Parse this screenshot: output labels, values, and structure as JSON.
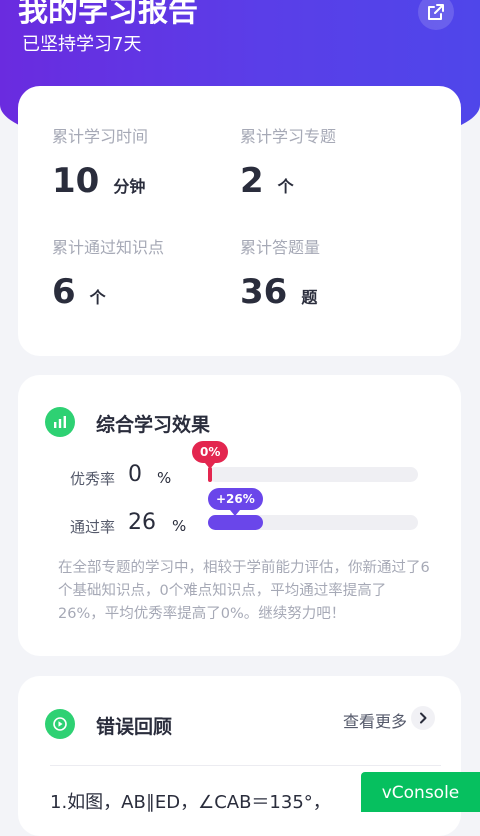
{
  "header": {
    "title": "我的学习报告",
    "subtitle": "已坚持学习7天",
    "share_icon": "share-external-icon"
  },
  "stats": [
    {
      "label": "累计学习时间",
      "value": "10",
      "unit": "分钟"
    },
    {
      "label": "累计学习专题",
      "value": "2",
      "unit": "个"
    },
    {
      "label": "累计通过知识点",
      "value": "6",
      "unit": "个"
    },
    {
      "label": "累计答题量",
      "value": "36",
      "unit": "题"
    }
  ],
  "effect": {
    "title": "综合学习效果",
    "icon": "bar-chart-icon",
    "rates": [
      {
        "label": "优秀率",
        "value": "0",
        "unit": "%",
        "bubble": "0%",
        "fraction": 0.0,
        "color": "#e3264f"
      },
      {
        "label": "通过率",
        "value": "26",
        "unit": "%",
        "bubble": "+26%",
        "fraction": 0.26,
        "color": "#6a46ea"
      }
    ],
    "summary": "在全部专题的学习中，相较于学前能力评估，你新通过了6个基础知识点，0个难点知识点，平均通过率提高了26%，平均优秀率提高了0%。继续努力吧！"
  },
  "review": {
    "title": "错误回顾",
    "icon": "play-icon",
    "more_label": "查看更多",
    "more_icon": "chevron-right-icon",
    "first_question": "1.如图，AB∥ED，∠CAB＝135°，"
  },
  "vconsole": {
    "label": "vConsole"
  },
  "colors": {
    "accent": "#5a3ee8",
    "green": "#2ed173",
    "red": "#e3264f"
  }
}
